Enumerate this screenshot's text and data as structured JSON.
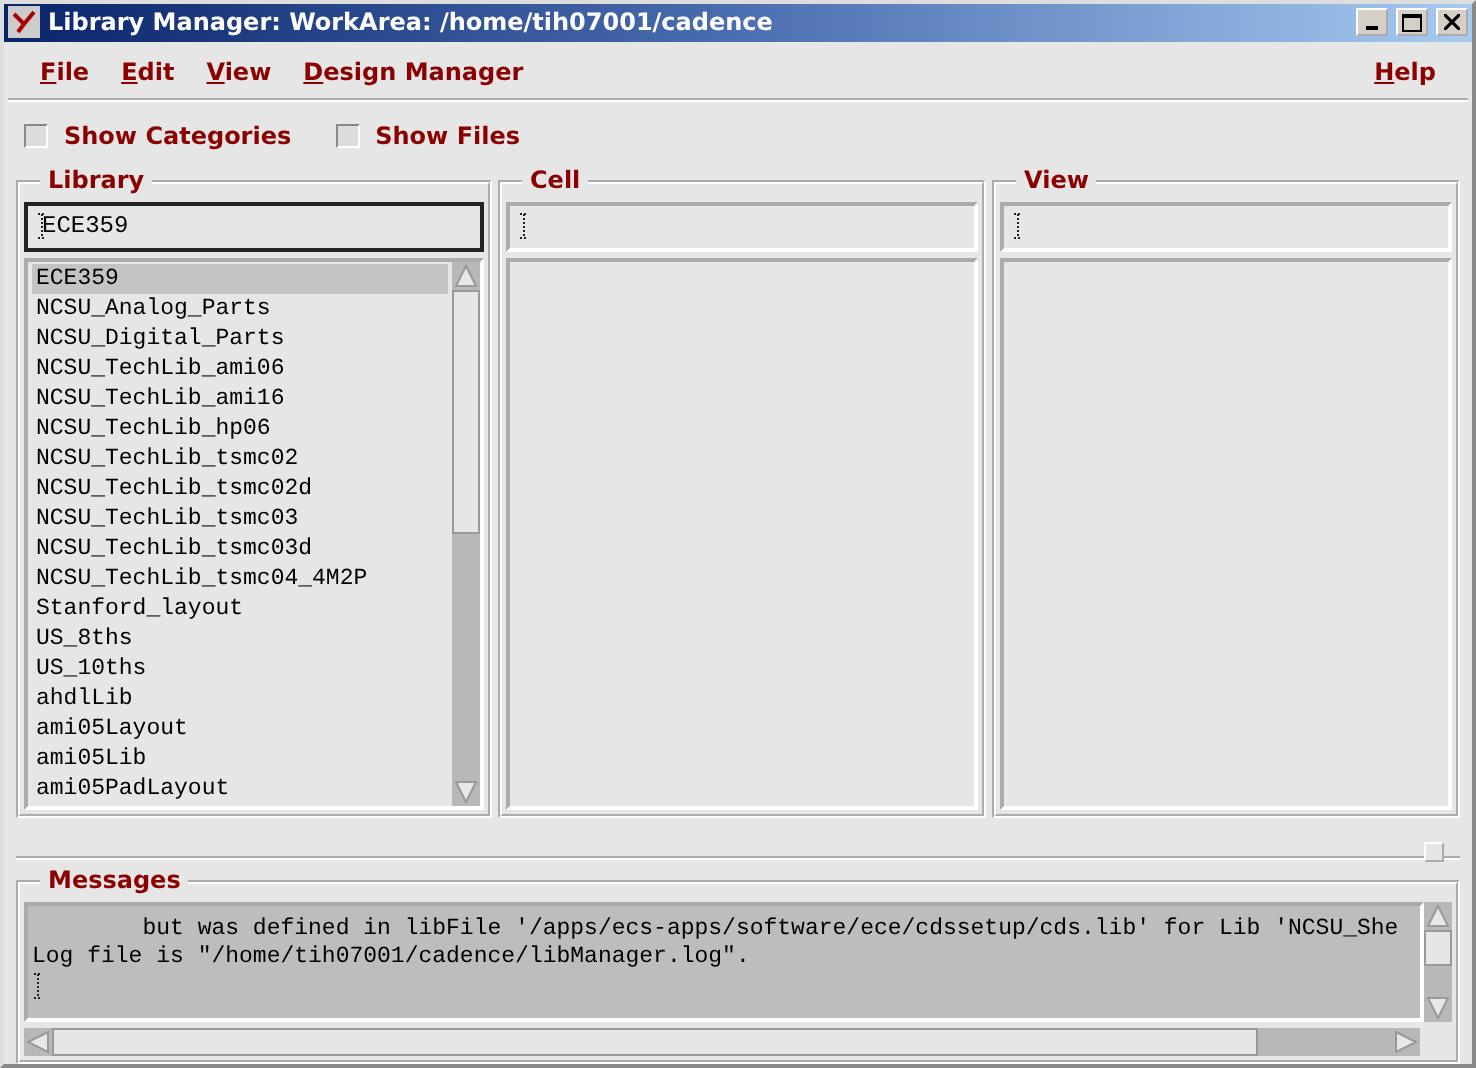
{
  "window": {
    "title": "Library Manager: WorkArea: /home/tih07001/cadence"
  },
  "menu": [
    "File",
    "Edit",
    "View",
    "Design Manager"
  ],
  "help_menu": "Help",
  "options": [
    {
      "label": "Show Categories",
      "checked": false
    },
    {
      "label": "Show Files",
      "checked": false
    }
  ],
  "library": {
    "title": "Library",
    "value": "ECE359",
    "items": [
      {
        "label": "ECE359",
        "selected": true
      },
      {
        "label": "NCSU_Analog_Parts",
        "selected": false
      },
      {
        "label": "NCSU_Digital_Parts",
        "selected": false
      },
      {
        "label": "NCSU_TechLib_ami06",
        "selected": false
      },
      {
        "label": "NCSU_TechLib_ami16",
        "selected": false
      },
      {
        "label": "NCSU_TechLib_hp06",
        "selected": false
      },
      {
        "label": "NCSU_TechLib_tsmc02",
        "selected": false
      },
      {
        "label": "NCSU_TechLib_tsmc02d",
        "selected": false
      },
      {
        "label": "NCSU_TechLib_tsmc03",
        "selected": false
      },
      {
        "label": "NCSU_TechLib_tsmc03d",
        "selected": false
      },
      {
        "label": "NCSU_TechLib_tsmc04_4M2P",
        "selected": false
      },
      {
        "label": "Stanford_layout",
        "selected": false
      },
      {
        "label": "US_8ths",
        "selected": false
      },
      {
        "label": "US_10ths",
        "selected": false
      },
      {
        "label": "ahdlLib",
        "selected": false
      },
      {
        "label": "ami05Layout",
        "selected": false
      },
      {
        "label": "ami05Lib",
        "selected": false
      },
      {
        "label": "ami05PadLayout",
        "selected": false
      }
    ]
  },
  "cell": {
    "title": "Cell"
  },
  "view": {
    "title": "View"
  },
  "messages": {
    "title": "Messages",
    "lines": [
      "        but was defined in libFile '/apps/ecs-apps/software/ece/cdssetup/cds.lib' for Lib 'NCSU_She",
      "Log file is \"/home/tih07001/cadence/libManager.log\"."
    ]
  }
}
